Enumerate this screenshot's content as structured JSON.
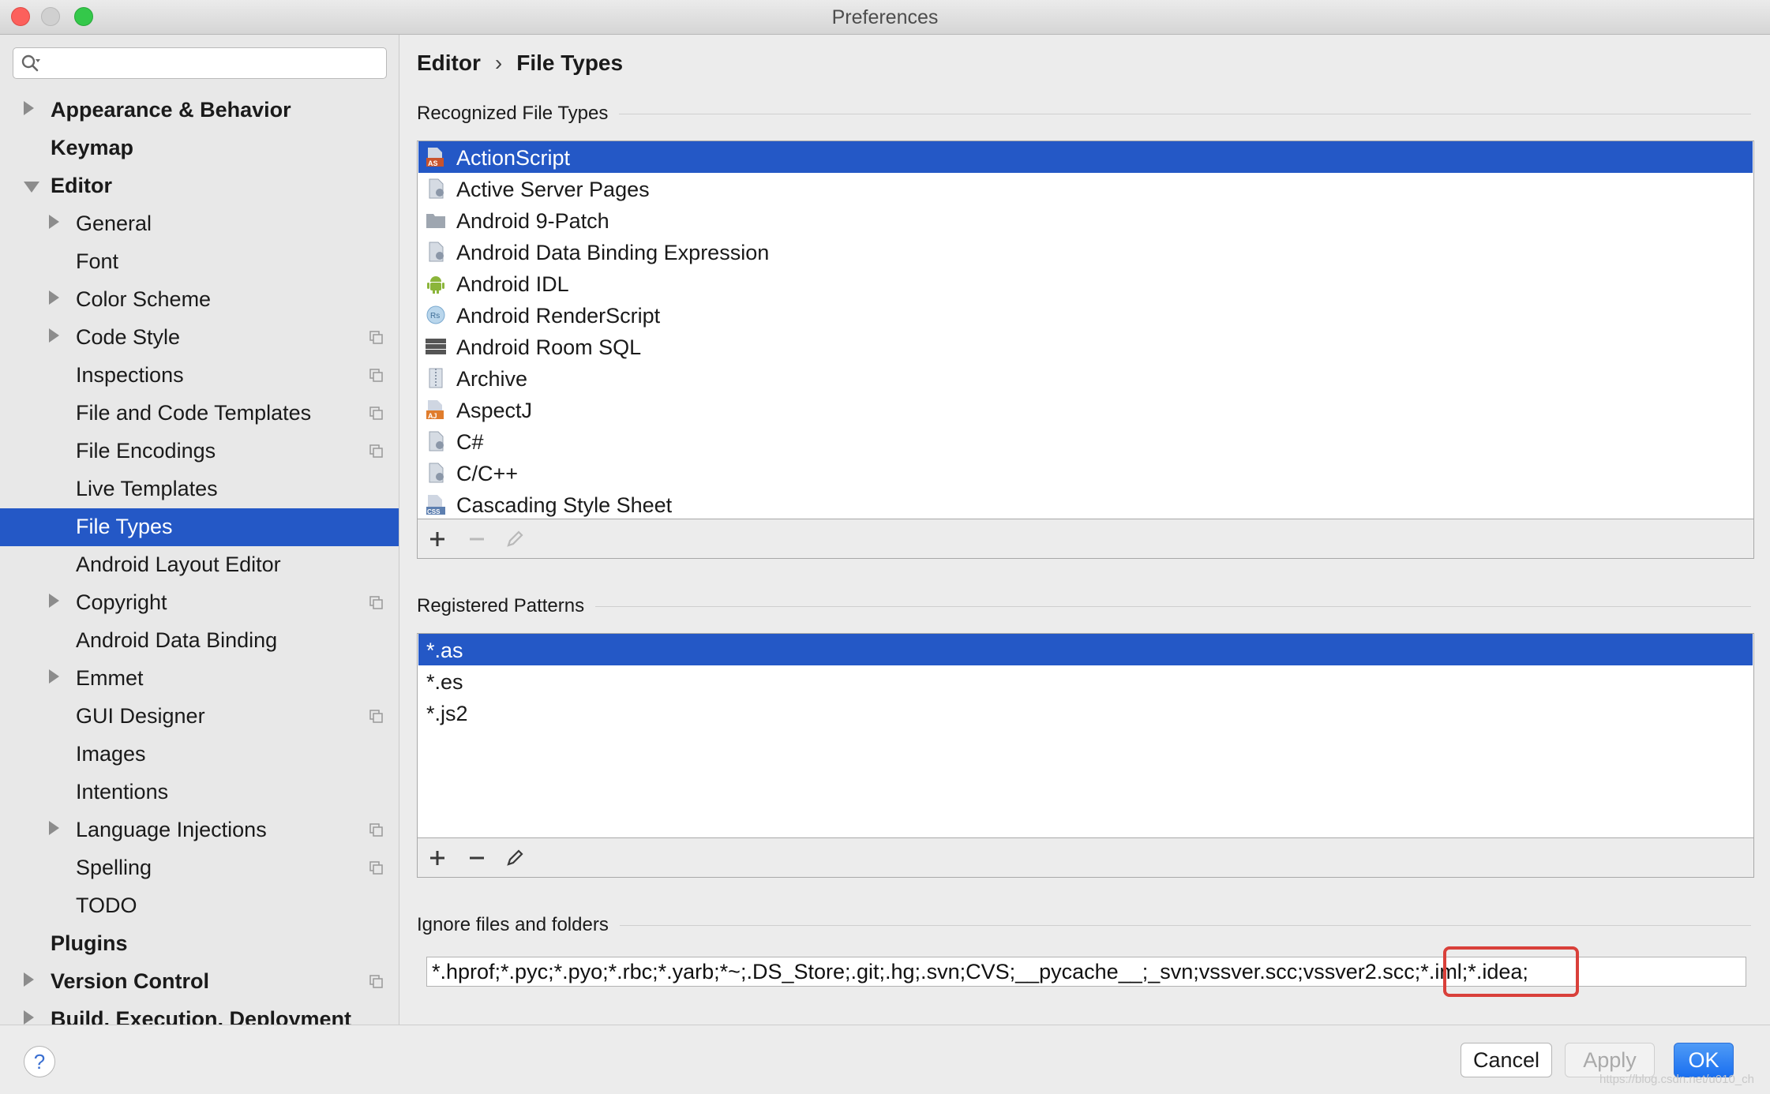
{
  "window": {
    "title": "Preferences"
  },
  "search": {
    "value": ""
  },
  "sidebar": {
    "items": [
      {
        "label": "Appearance & Behavior"
      },
      {
        "label": "Keymap"
      },
      {
        "label": "Editor"
      },
      {
        "label": "General"
      },
      {
        "label": "Font"
      },
      {
        "label": "Color Scheme"
      },
      {
        "label": "Code Style"
      },
      {
        "label": "Inspections"
      },
      {
        "label": "File and Code Templates"
      },
      {
        "label": "File Encodings"
      },
      {
        "label": "Live Templates"
      },
      {
        "label": "File Types"
      },
      {
        "label": "Android Layout Editor"
      },
      {
        "label": "Copyright"
      },
      {
        "label": "Android Data Binding"
      },
      {
        "label": "Emmet"
      },
      {
        "label": "GUI Designer"
      },
      {
        "label": "Images"
      },
      {
        "label": "Intentions"
      },
      {
        "label": "Language Injections"
      },
      {
        "label": "Spelling"
      },
      {
        "label": "TODO"
      },
      {
        "label": "Plugins"
      },
      {
        "label": "Version Control"
      },
      {
        "label": "Build, Execution, Deployment"
      }
    ]
  },
  "breadcrumb": {
    "parent": "Editor",
    "separator": "›",
    "current": "File Types"
  },
  "recognized": {
    "title": "Recognized File Types",
    "items": [
      {
        "label": "ActionScript",
        "icon": "actionscript-icon"
      },
      {
        "label": "Active Server Pages",
        "icon": "file-type-icon"
      },
      {
        "label": "Android 9-Patch",
        "icon": "folder-icon"
      },
      {
        "label": "Android Data Binding Expression",
        "icon": "file-type-icon"
      },
      {
        "label": "Android IDL",
        "icon": "android-icon"
      },
      {
        "label": "Android RenderScript",
        "icon": "renderscript-icon"
      },
      {
        "label": "Android Room SQL",
        "icon": "database-icon"
      },
      {
        "label": "Archive",
        "icon": "archive-icon"
      },
      {
        "label": "AspectJ",
        "icon": "aspectj-icon"
      },
      {
        "label": "C#",
        "icon": "file-type-icon"
      },
      {
        "label": "C/C++",
        "icon": "file-type-icon"
      },
      {
        "label": "Cascading Style Sheet",
        "icon": "css-icon"
      }
    ]
  },
  "patterns": {
    "title": "Registered Patterns",
    "items": [
      {
        "label": "*.as"
      },
      {
        "label": "*.es"
      },
      {
        "label": "*.js2"
      }
    ]
  },
  "ignore": {
    "title": "Ignore files and folders",
    "value": "*.hprof;*.pyc;*.pyo;*.rbc;*.yarb;*~;.DS_Store;.git;.hg;.svn;CVS;__pycache__;_svn;vssver.scc;vssver2.scc;*.iml;*.idea;"
  },
  "buttons": {
    "cancel": "Cancel",
    "apply": "Apply",
    "ok": "OK",
    "help": "?"
  },
  "watermark": "https://blog.csdn.net/u010_ch",
  "colors": {
    "selection": "#2458c6",
    "highlight": "#d9403a",
    "ok": "#1a6ff0"
  }
}
